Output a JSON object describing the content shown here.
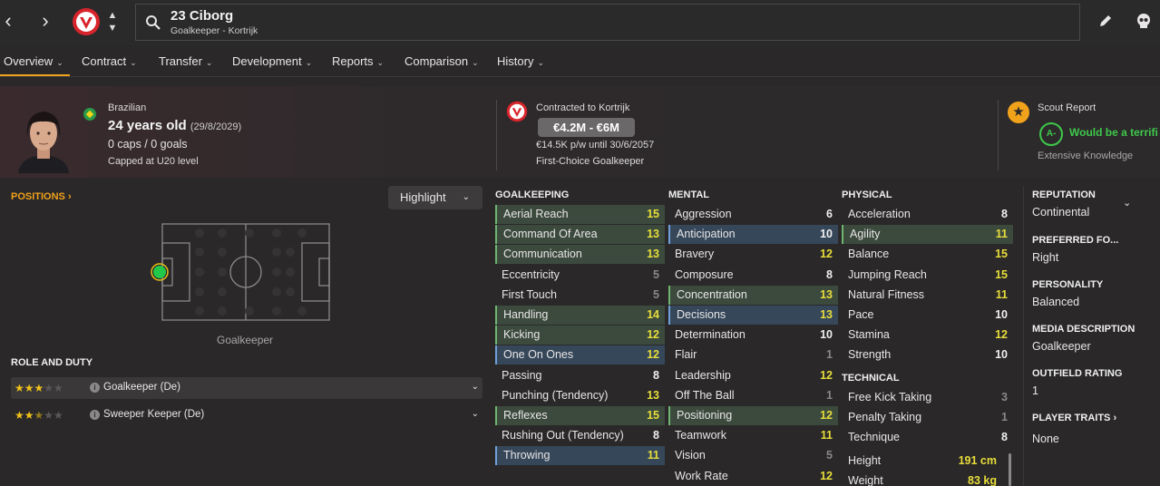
{
  "topbar": {
    "player_title": "23 Ciborg",
    "player_subtitle": "Goalkeeper - Kortrijk",
    "icons": [
      "back-arrow-icon",
      "forward-arrow-icon",
      "club-crest-icon",
      "search-icon",
      "edit-pencil-icon",
      "skull-icon"
    ]
  },
  "tabs": [
    {
      "label": "Overview",
      "active": true
    },
    {
      "label": "Contract"
    },
    {
      "label": "Transfer"
    },
    {
      "label": "Development"
    },
    {
      "label": "Reports"
    },
    {
      "label": "Comparison"
    },
    {
      "label": "History"
    }
  ],
  "header": {
    "nationality": "Brazilian",
    "age": "24 years old",
    "dob": "(29/8/2029)",
    "caps": "0 caps / 0 goals",
    "capped_level": "Capped at U20 level",
    "contracted_to": "Contracted to Kortrijk",
    "value_range": "€4.2M - €6M",
    "wage": "€14.5K p/w until 30/6/2057",
    "squad_status": "First-Choice Goalkeeper",
    "scout_report_label": "Scout Report",
    "scout_grade": "A-",
    "scout_verdict": "Would be a terrifi",
    "knowledge": "Extensive Knowledge"
  },
  "left_panel": {
    "positions_label": "POSITIONS ›",
    "highlight_label": "Highlight",
    "pitch_caption": "Goalkeeper",
    "role_heading": "ROLE AND DUTY",
    "roles": [
      {
        "name": "Goalkeeper (De)",
        "stars": 3
      },
      {
        "name": "Sweeper Keeper (De)",
        "stars": 2.5
      }
    ]
  },
  "attributes": {
    "goalkeeping": {
      "heading": "GOALKEEPING",
      "items": [
        {
          "name": "Aerial Reach",
          "value": "15",
          "hl": "green"
        },
        {
          "name": "Command Of Area",
          "value": "13",
          "hl": "green"
        },
        {
          "name": "Communication",
          "value": "13",
          "hl": "green"
        },
        {
          "name": "Eccentricity",
          "value": "5",
          "hl": ""
        },
        {
          "name": "First Touch",
          "value": "5",
          "hl": ""
        },
        {
          "name": "Handling",
          "value": "14",
          "hl": "green"
        },
        {
          "name": "Kicking",
          "value": "12",
          "hl": "green"
        },
        {
          "name": "One On Ones",
          "value": "12",
          "hl": "blue"
        },
        {
          "name": "Passing",
          "value": "8",
          "hl": ""
        },
        {
          "name": "Punching (Tendency)",
          "value": "13",
          "hl": ""
        },
        {
          "name": "Reflexes",
          "value": "15",
          "hl": "green"
        },
        {
          "name": "Rushing Out (Tendency)",
          "value": "8",
          "hl": ""
        },
        {
          "name": "Throwing",
          "value": "11",
          "hl": "blue"
        }
      ]
    },
    "mental": {
      "heading": "MENTAL",
      "items": [
        {
          "name": "Aggression",
          "value": "6",
          "hl": ""
        },
        {
          "name": "Anticipation",
          "value": "10",
          "hl": "blue"
        },
        {
          "name": "Bravery",
          "value": "12",
          "hl": ""
        },
        {
          "name": "Composure",
          "value": "8",
          "hl": ""
        },
        {
          "name": "Concentration",
          "value": "13",
          "hl": "green"
        },
        {
          "name": "Decisions",
          "value": "13",
          "hl": "blue"
        },
        {
          "name": "Determination",
          "value": "10",
          "hl": ""
        },
        {
          "name": "Flair",
          "value": "1",
          "hl": ""
        },
        {
          "name": "Leadership",
          "value": "12",
          "hl": ""
        },
        {
          "name": "Off The Ball",
          "value": "1",
          "hl": ""
        },
        {
          "name": "Positioning",
          "value": "12",
          "hl": "green"
        },
        {
          "name": "Teamwork",
          "value": "11",
          "hl": ""
        },
        {
          "name": "Vision",
          "value": "5",
          "hl": ""
        },
        {
          "name": "Work Rate",
          "value": "12",
          "hl": ""
        }
      ]
    },
    "physical": {
      "heading": "PHYSICAL",
      "items": [
        {
          "name": "Acceleration",
          "value": "8",
          "hl": ""
        },
        {
          "name": "Agility",
          "value": "11",
          "hl": "green"
        },
        {
          "name": "Balance",
          "value": "15",
          "hl": ""
        },
        {
          "name": "Jumping Reach",
          "value": "15",
          "hl": ""
        },
        {
          "name": "Natural Fitness",
          "value": "11",
          "hl": ""
        },
        {
          "name": "Pace",
          "value": "10",
          "hl": ""
        },
        {
          "name": "Stamina",
          "value": "12",
          "hl": ""
        },
        {
          "name": "Strength",
          "value": "10",
          "hl": ""
        }
      ]
    },
    "technical": {
      "heading": "TECHNICAL",
      "items": [
        {
          "name": "Free Kick Taking",
          "value": "3",
          "hl": ""
        },
        {
          "name": "Penalty Taking",
          "value": "1",
          "hl": ""
        },
        {
          "name": "Technique",
          "value": "8",
          "hl": ""
        }
      ]
    },
    "body": [
      {
        "name": "Height",
        "value": "191 cm"
      },
      {
        "name": "Weight",
        "value": "83 kg"
      }
    ]
  },
  "right_panel": {
    "reputation_head": "REPUTATION",
    "reputation": "Continental",
    "foot_head": "PREFERRED FO...",
    "foot": "Right",
    "personality_head": "PERSONALITY",
    "personality": "Balanced",
    "media_head": "MEDIA DESCRIPTION",
    "media": "Goalkeeper",
    "outfield_head": "OUTFIELD RATING",
    "outfield": "1",
    "traits_head": "PLAYER TRAITS ›",
    "traits": "None"
  },
  "colors": {
    "accent": "#f0a21b",
    "high_value": "#e8de3a",
    "low_value": "#8a8889",
    "scout_green": "#3ec84b"
  }
}
